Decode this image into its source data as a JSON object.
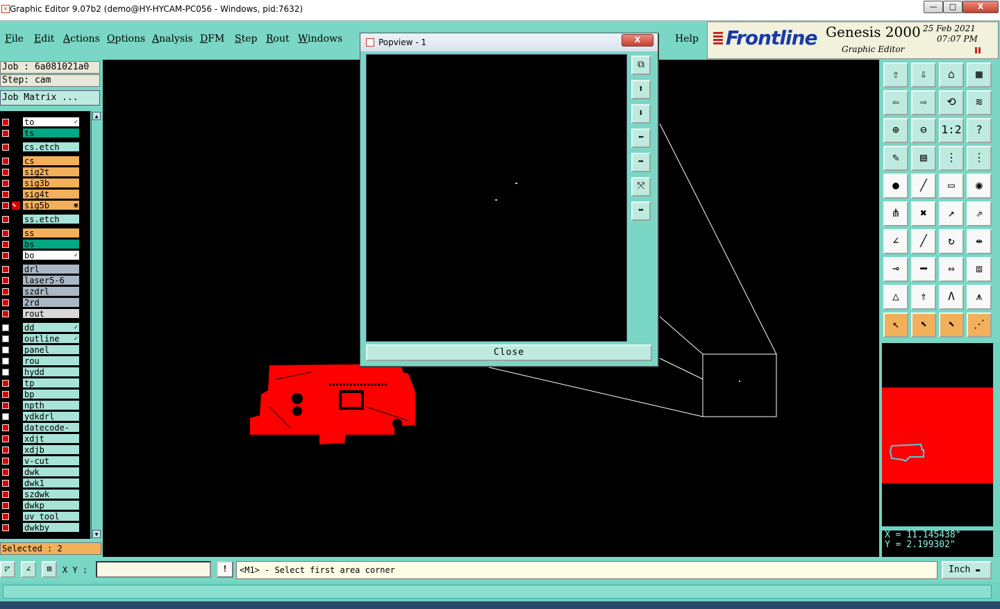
{
  "window": {
    "title": "Graphic Editor 9.07b2 (demo@HY-HYCAM-PC056 - Windows, pid:7632)",
    "min_label": "—",
    "max_label": "□",
    "close_label": "X"
  },
  "menu": {
    "items": [
      "File",
      "Edit",
      "Actions",
      "Options",
      "Analysis",
      "DFM",
      "Step",
      "Rout",
      "Windows"
    ],
    "help": "Help"
  },
  "brand": {
    "logo": "Frontline",
    "product": "Genesis 2000",
    "subtitle": "Graphic Editor",
    "date": "25 Feb 2021",
    "time": "07:07 PM"
  },
  "job": {
    "job_line": "Job : 6a081021a0",
    "step_line": "Step: cam",
    "matrix_button": "Job Matrix ..."
  },
  "layers": [
    {
      "name": "to",
      "color": "#ffffff",
      "checked": true,
      "mark": "✓"
    },
    {
      "name": "ts",
      "color": "#00a884",
      "checked": true,
      "mark": ""
    },
    {
      "name": "cs.etch",
      "color": "#a8e3d8",
      "checked": true,
      "mark": ""
    },
    {
      "name": "cs",
      "color": "#f2b05a",
      "checked": true,
      "mark": ""
    },
    {
      "name": "sig2t",
      "color": "#f2b05a",
      "checked": true,
      "mark": ""
    },
    {
      "name": "sig3b",
      "color": "#f2b05a",
      "checked": true,
      "mark": ""
    },
    {
      "name": "sig4t",
      "color": "#f2b05a",
      "checked": true,
      "mark": ""
    },
    {
      "name": "sig5b",
      "color": "#f2b05a",
      "checked": true,
      "mark": "▣",
      "active": true
    },
    {
      "name": "ss.etch",
      "color": "#a8e3d8",
      "checked": true,
      "mark": ""
    },
    {
      "name": "ss",
      "color": "#f2b05a",
      "checked": true,
      "mark": ""
    },
    {
      "name": "bs",
      "color": "#00a884",
      "checked": true,
      "mark": ""
    },
    {
      "name": "bo",
      "color": "#ffffff",
      "checked": true,
      "mark": "✓"
    },
    {
      "name": "drl",
      "color": "#a9b8c4",
      "checked": true,
      "mark": ""
    },
    {
      "name": "laser5-6",
      "color": "#a9b8c4",
      "checked": true,
      "mark": ""
    },
    {
      "name": "szdrl",
      "color": "#a9b8c4",
      "checked": true,
      "mark": ""
    },
    {
      "name": "2rd",
      "color": "#a9b8c4",
      "checked": true,
      "mark": ""
    },
    {
      "name": "rout",
      "color": "#d8d8d8",
      "checked": true,
      "mark": ""
    },
    {
      "name": "dd",
      "color": "#a8e3d8",
      "checked": false,
      "mark": "✓"
    },
    {
      "name": "outline",
      "color": "#a8e3d8",
      "checked": false,
      "mark": "✓"
    },
    {
      "name": "panel",
      "color": "#a8e3d8",
      "checked": false,
      "mark": ""
    },
    {
      "name": "rou",
      "color": "#a8e3d8",
      "checked": false,
      "mark": ""
    },
    {
      "name": "hydd",
      "color": "#a8e3d8",
      "checked": false,
      "mark": ""
    },
    {
      "name": "tp",
      "color": "#a8e3d8",
      "checked": true,
      "mark": ""
    },
    {
      "name": "bp",
      "color": "#a8e3d8",
      "checked": true,
      "mark": ""
    },
    {
      "name": "npth",
      "color": "#a8e3d8",
      "checked": true,
      "mark": ""
    },
    {
      "name": "ydkdrl",
      "color": "#a8e3d8",
      "checked": false,
      "mark": ""
    },
    {
      "name": "datecode-pte",
      "color": "#a8e3d8",
      "checked": true,
      "mark": ""
    },
    {
      "name": "xdjt",
      "color": "#a8e3d8",
      "checked": true,
      "mark": ""
    },
    {
      "name": "xdjb",
      "color": "#a8e3d8",
      "checked": true,
      "mark": ""
    },
    {
      "name": "v-cut",
      "color": "#a8e3d8",
      "checked": true,
      "mark": ""
    },
    {
      "name": "dwk",
      "color": "#a8e3d8",
      "checked": true,
      "mark": ""
    },
    {
      "name": "dwk1",
      "color": "#a8e3d8",
      "checked": true,
      "mark": ""
    },
    {
      "name": "szdwk",
      "color": "#a8e3d8",
      "checked": true,
      "mark": ""
    },
    {
      "name": "dwkp",
      "color": "#a8e3d8",
      "checked": true,
      "mark": ""
    },
    {
      "name": "uv_tool",
      "color": "#a8e3d8",
      "checked": true,
      "mark": ""
    },
    {
      "name": "dwkby",
      "color": "#a8e3d8",
      "checked": true,
      "mark": ""
    }
  ],
  "selected": "Selected : 2",
  "popview": {
    "title": "Popview - 1",
    "close_x": "X",
    "close_button": "Close",
    "tools": [
      "zoom-fit-icon",
      "move-up-icon",
      "move-down-icon",
      "move-left-icon",
      "move-right-icon",
      "zoom-in-icon",
      "zoom-out-icon"
    ]
  },
  "toolbox": {
    "tools": [
      "pan-up-icon",
      "pan-down-icon",
      "home-icon",
      "window-icon",
      "pan-left-icon",
      "pan-right-icon",
      "redraw-icon",
      "refresh-icon",
      "zoom-in-icon",
      "zoom-out-icon",
      "zoom-1to1-icon",
      "help-icon",
      "measure-icon",
      "grid-icon",
      "snap-icon",
      "snap-alt-icon",
      "add-pad-icon",
      "add-line-icon",
      "ruler-icon",
      "circle-pad-icon",
      "connect-icon",
      "delete-icon",
      "move-icon",
      "copy-icon",
      "arc-left-icon",
      "line-icon",
      "rotate-icon",
      "mirror-icon",
      "stretch-icon",
      "cut-icon",
      "resize-icon",
      "replace-icon",
      "triangle-icon",
      "arrow-up-icon",
      "a-shape-icon",
      "a-line-icon",
      "select-icon",
      "select-box-icon",
      "select-alt-icon",
      "select-net-icon"
    ],
    "labels": {
      "zoom-1to1-icon": "1:2",
      "help-icon": "?"
    }
  },
  "coords": {
    "x": "X = 11.145438\"",
    "y": "Y = 2.199302\""
  },
  "status": {
    "xy_label": "X Y :",
    "xy_value": "",
    "warn": "!",
    "prompt": "<M1> - Select first area corner",
    "units": "Inch"
  },
  "colors": {
    "accent": "#7ad7c5",
    "board": "#ff0000",
    "canvas": "#000000"
  }
}
